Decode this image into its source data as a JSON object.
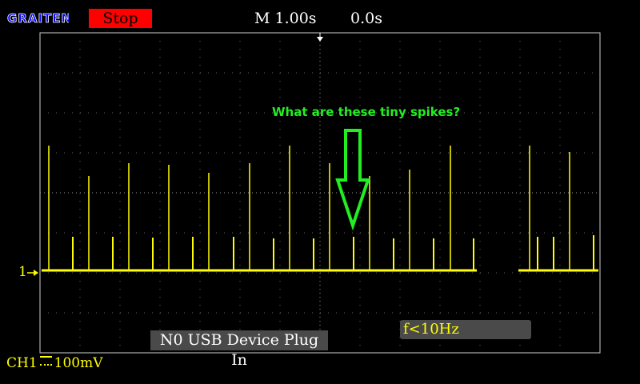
{
  "header": {
    "brand": "GRAITEN",
    "status": "Stop",
    "timebase": "M 1.00s",
    "trigger_offset": "0.0s"
  },
  "channel": {
    "marker": "1",
    "name": "CH1",
    "scale": "100mV",
    "coupling_icon": "dc-coupling-icon"
  },
  "messages": {
    "usb": "N0 USB Device Plug In",
    "frequency": "f<10Hz"
  },
  "annotation": {
    "text": "What are these tiny spikes?"
  },
  "colors": {
    "background": "#000000",
    "trace": "#ffff00",
    "stop_badge": "#ff0000",
    "logo": "#0000ff",
    "annotation": "#22ee22",
    "message_box": "#4a4a4a"
  }
}
